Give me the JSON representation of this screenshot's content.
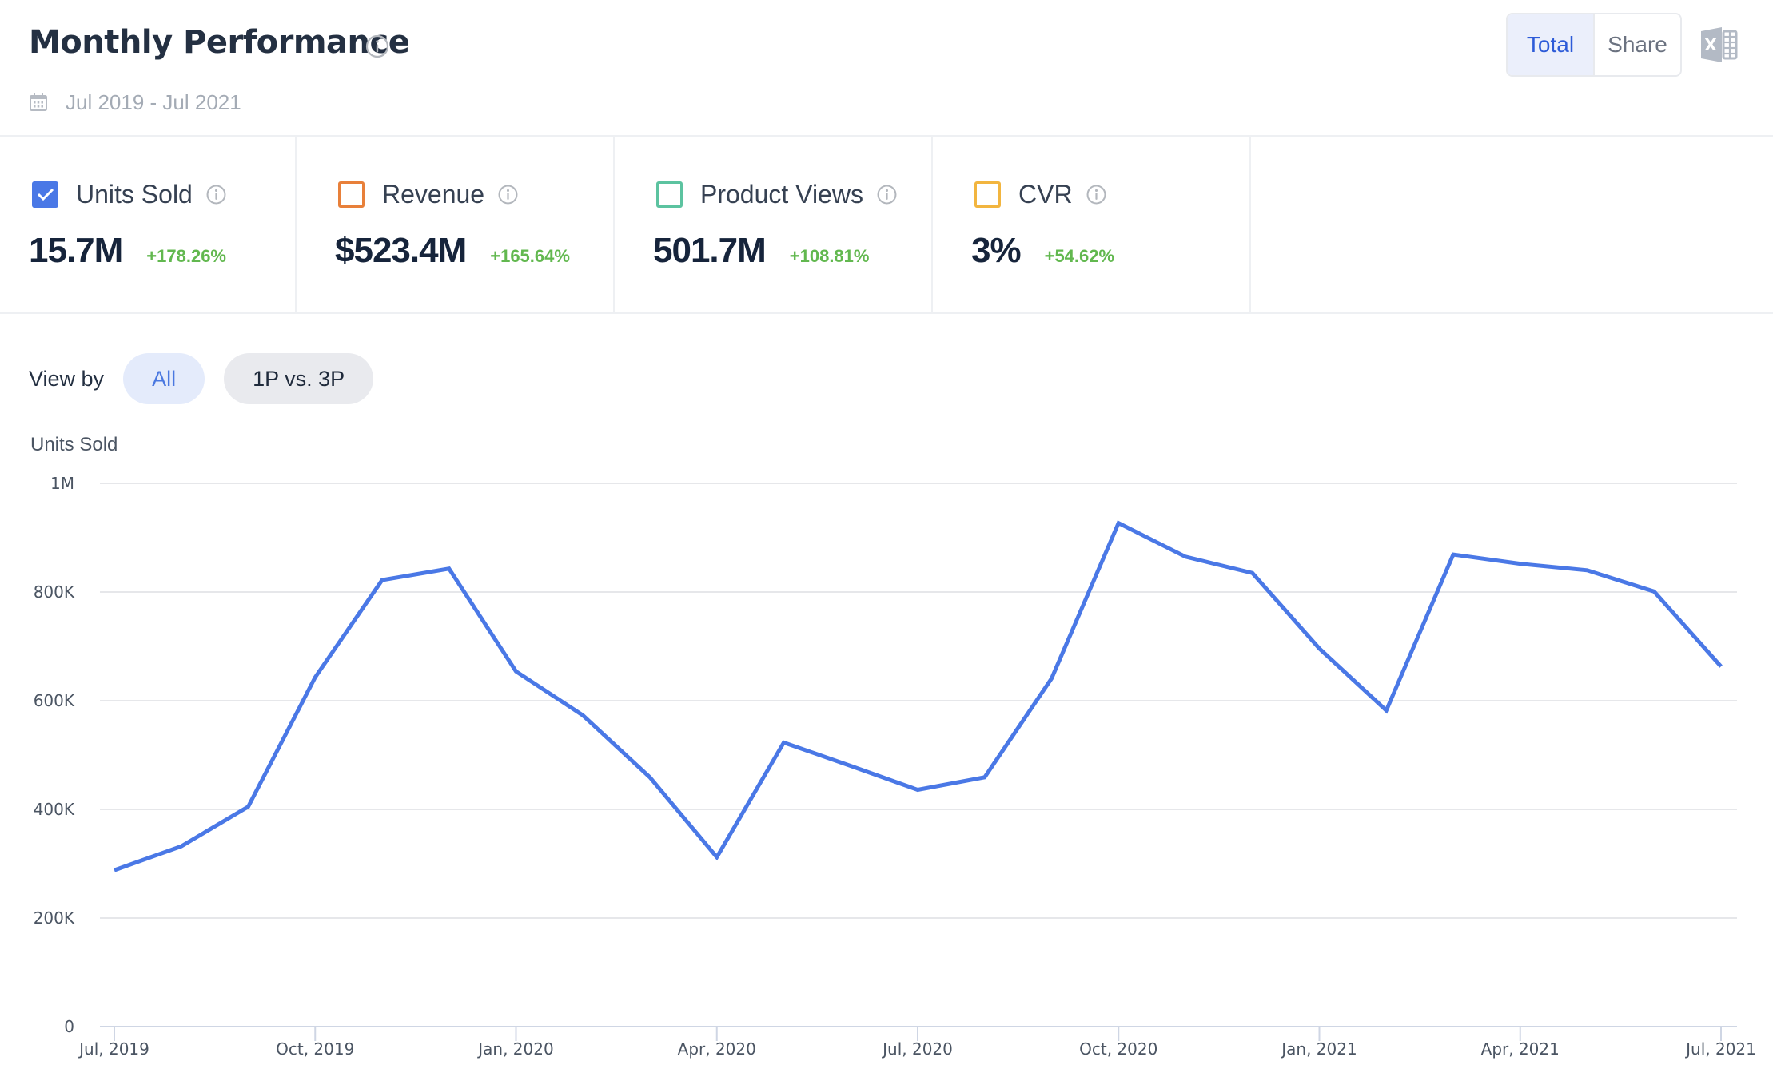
{
  "header": {
    "title": "Monthly Performance",
    "title_info_icon": "info-circle-icon",
    "date_icon": "calendar-icon",
    "date_range": "Jul 2019 - Jul 2021",
    "toggle": [
      {
        "label": "Total",
        "active": true
      },
      {
        "label": "Share",
        "active": false
      }
    ],
    "export_icon": "excel-export-icon"
  },
  "metrics": [
    {
      "label": "Units Sold",
      "value": "15.7M",
      "change": "+178.26%",
      "checked": true,
      "color": "#4a78e6"
    },
    {
      "label": "Revenue",
      "value": "$523.4M",
      "change": "+165.64%",
      "checked": false,
      "color": "#e8803a"
    },
    {
      "label": "Product Views",
      "value": "501.7M",
      "change": "+108.81%",
      "checked": false,
      "color": "#5cc3a0"
    },
    {
      "label": "CVR",
      "value": "3%",
      "change": "+54.62%",
      "checked": false,
      "color": "#f2b53f"
    }
  ],
  "view_by": {
    "label": "View by",
    "options": [
      {
        "label": "All",
        "active": true
      },
      {
        "label": "1P vs. 3P",
        "active": false
      }
    ]
  },
  "colors": {
    "line": "#4a78e6",
    "positive_change": "#62b84f",
    "grid": "#e6e7ea",
    "axis": "#cfd6e4"
  },
  "chart_data": {
    "type": "line",
    "title": "",
    "xlabel": "",
    "ylabel": "Units Sold",
    "ylim": [
      0,
      1000000
    ],
    "yticks": [
      0,
      200000,
      400000,
      600000,
      800000,
      1000000
    ],
    "ytick_labels": [
      "0",
      "200K",
      "400K",
      "600K",
      "800K",
      "1M"
    ],
    "xtick_labels": [
      "Jul, 2019",
      "Oct, 2019",
      "Jan, 2020",
      "Apr, 2020",
      "Jul, 2020",
      "Oct, 2020",
      "Jan, 2021",
      "Apr, 2021",
      "Jul, 2021"
    ],
    "xtick_month_index": [
      0,
      3,
      6,
      9,
      12,
      15,
      18,
      21,
      24
    ],
    "grid": true,
    "legend": "none",
    "x": [
      "Jul 2019",
      "Aug 2019",
      "Sep 2019",
      "Oct 2019",
      "Nov 2019",
      "Dec 2019",
      "Jan 2020",
      "Feb 2020",
      "Mar 2020",
      "Apr 2020",
      "May 2020",
      "Jun 2020",
      "Jul 2020",
      "Aug 2020",
      "Sep 2020",
      "Oct 2020",
      "Nov 2020",
      "Dec 2020",
      "Jan 2021",
      "Feb 2021",
      "Mar 2021",
      "Apr 2021",
      "May 2021",
      "Jun 2021",
      "Jul 2021"
    ],
    "series": [
      {
        "name": "Units Sold",
        "values": [
          288000,
          332000,
          405000,
          643000,
          822000,
          843000,
          654000,
          573000,
          459000,
          312000,
          523000,
          480000,
          436000,
          459000,
          641000,
          927000,
          865000,
          835000,
          696000,
          582000,
          869000,
          852000,
          840000,
          801000,
          663000
        ]
      }
    ]
  }
}
